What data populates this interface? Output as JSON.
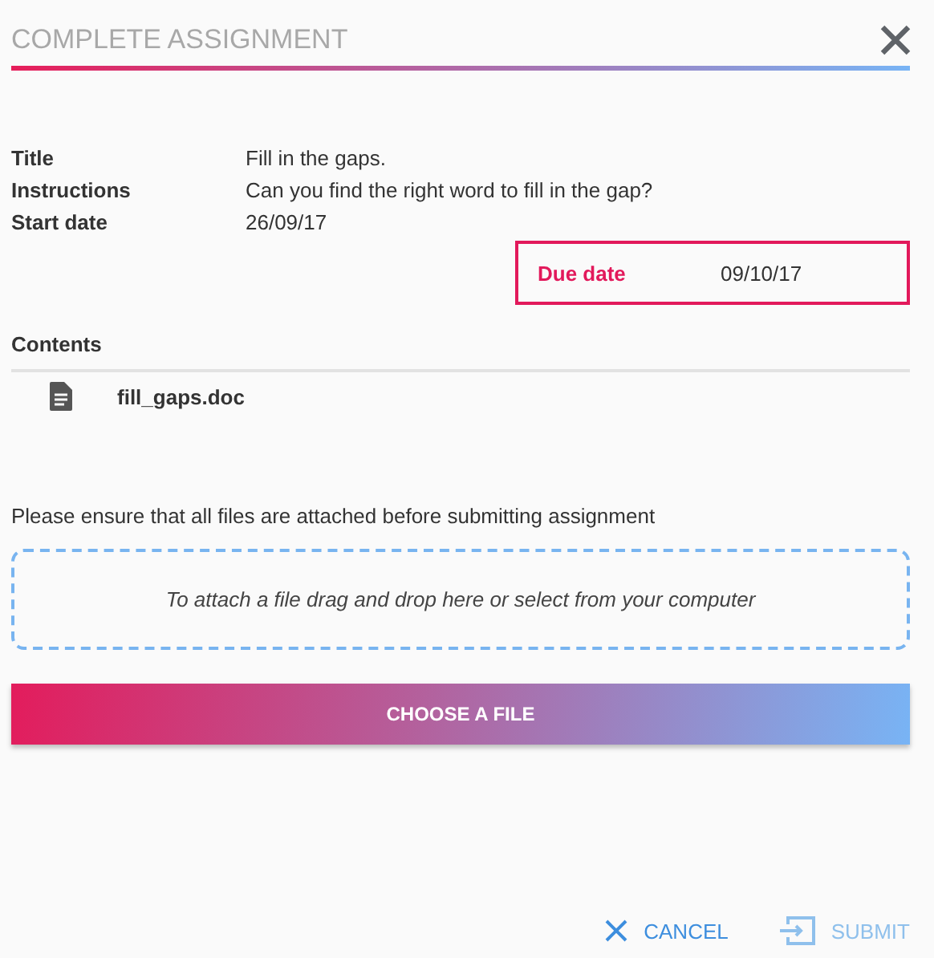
{
  "dialog": {
    "title": "COMPLETE ASSIGNMENT"
  },
  "details": [
    {
      "label": "Title",
      "value": "Fill in the gaps."
    },
    {
      "label": "Instructions",
      "value": "Can you find the right word to fill in the gap?"
    },
    {
      "label": "Start date",
      "value": "26/09/17"
    }
  ],
  "due_date": {
    "label": "Due date",
    "value": "09/10/17"
  },
  "contents": {
    "heading": "Contents",
    "files": [
      {
        "name": "fill_gaps.doc"
      }
    ]
  },
  "notice": "Please ensure that all files are attached before submitting assignment",
  "dropzone": {
    "text": "To attach a file drag and drop here or select from your computer"
  },
  "choose_button": "CHOOSE A FILE",
  "actions": [
    {
      "kind": "cancel",
      "label": "CANCEL",
      "disabled": false
    },
    {
      "kind": "submit",
      "label": "SUBMIT",
      "disabled": true
    }
  ]
}
